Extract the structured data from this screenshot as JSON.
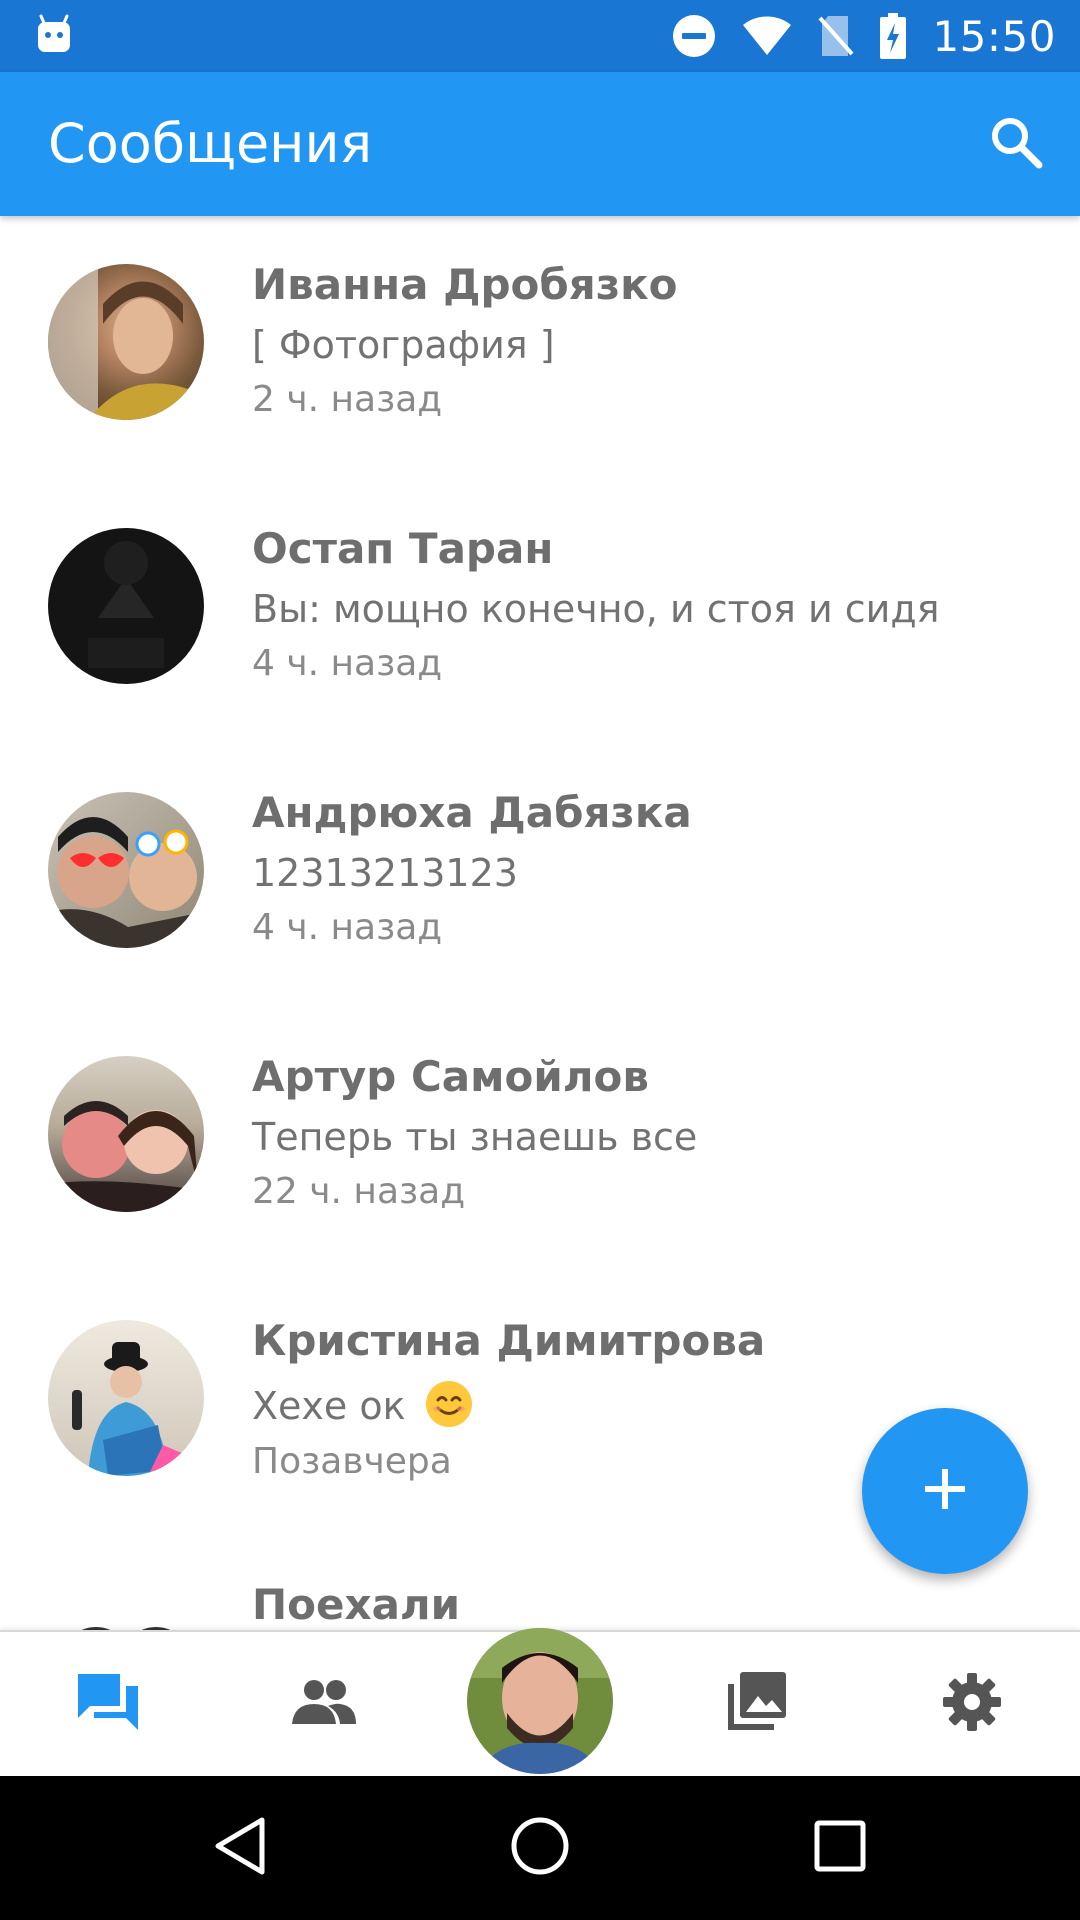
{
  "status_bar": {
    "time": "15:50",
    "icons": [
      "android-icon",
      "do-not-disturb-icon",
      "wifi-icon",
      "no-sim-icon",
      "battery-charging-icon"
    ]
  },
  "app_bar": {
    "title": "Сообщения",
    "search_icon": "search-icon"
  },
  "conversations": [
    {
      "name": "Иванна Дробязко",
      "preview": "[ Фотография ]",
      "time": "2 ч. назад"
    },
    {
      "name": "Остап Таран",
      "preview": "Вы: мощно конечно, и стоя и сидя",
      "time": "4 ч. назад"
    },
    {
      "name": "Андрюха Дабязка",
      "preview": "12313213123",
      "time": "4 ч. назад"
    },
    {
      "name": "Артур Самойлов",
      "preview": "Теперь ты знаешь все",
      "time": "22 ч. назад"
    },
    {
      "name": "Кристина Димитрова",
      "preview": "Хехе ок",
      "preview_emoji": "smiling-face-emoji",
      "time": "Позавчера"
    },
    {
      "name": "Поехали"
    }
  ],
  "fab": {
    "icon": "plus-icon"
  },
  "bottom_nav": {
    "items": [
      "messages-icon",
      "friends-icon",
      "profile-avatar",
      "photos-icon",
      "settings-icon"
    ],
    "active": "messages-icon"
  },
  "system_nav": [
    "back-icon",
    "home-icon",
    "recents-icon"
  ],
  "colors": {
    "status_bar": "#1976D2",
    "app_bar": "#2196F3",
    "accent": "#2196F3",
    "icon_gray": "#555555"
  }
}
